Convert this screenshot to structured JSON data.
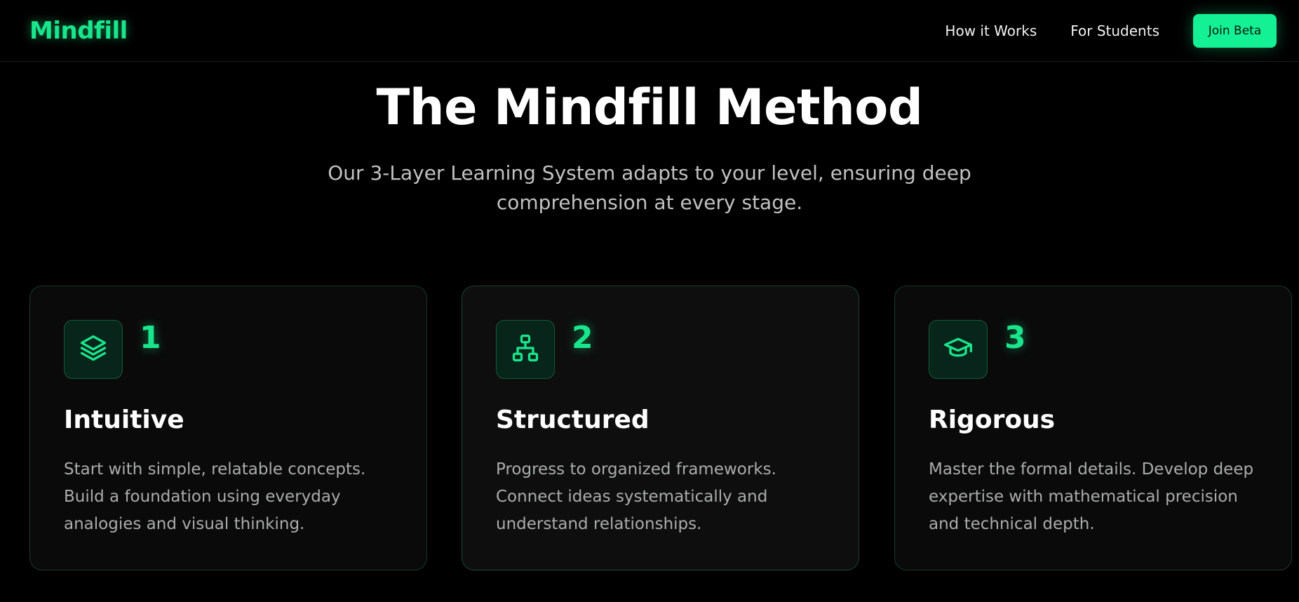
{
  "navbar": {
    "logo": "Mindfill",
    "links": [
      "How it Works",
      "For Students"
    ],
    "cta_label": "Join Beta"
  },
  "hero": {
    "title": "The Mindfill Method",
    "subtitle_line1": "Our 3-Layer Learning System adapts to your level, ensuring deep",
    "subtitle_line2": "comprehension at every stage."
  },
  "cards": [
    {
      "number": "1",
      "icon": "layers-icon",
      "title": "Intuitive",
      "lines": [
        "Start with simple, relatable concepts.",
        "Build a foundation using everyday",
        "analogies and visual thinking."
      ]
    },
    {
      "number": "2",
      "icon": "hierarchy-icon",
      "title": "Structured",
      "lines": [
        "Progress to organized frameworks.",
        "Connect ideas systematically and",
        "understand relationships."
      ]
    },
    {
      "number": "3",
      "icon": "graduation-cap-icon",
      "title": "Rigorous",
      "lines": [
        "Master the formal details. Develop deep",
        "expertise with mathematical precision",
        "and technical depth."
      ]
    }
  ],
  "colors": {
    "accent": "#14f195",
    "background": "#000000",
    "card_background": "#0a0a0a",
    "muted_text": "#a9adab"
  }
}
